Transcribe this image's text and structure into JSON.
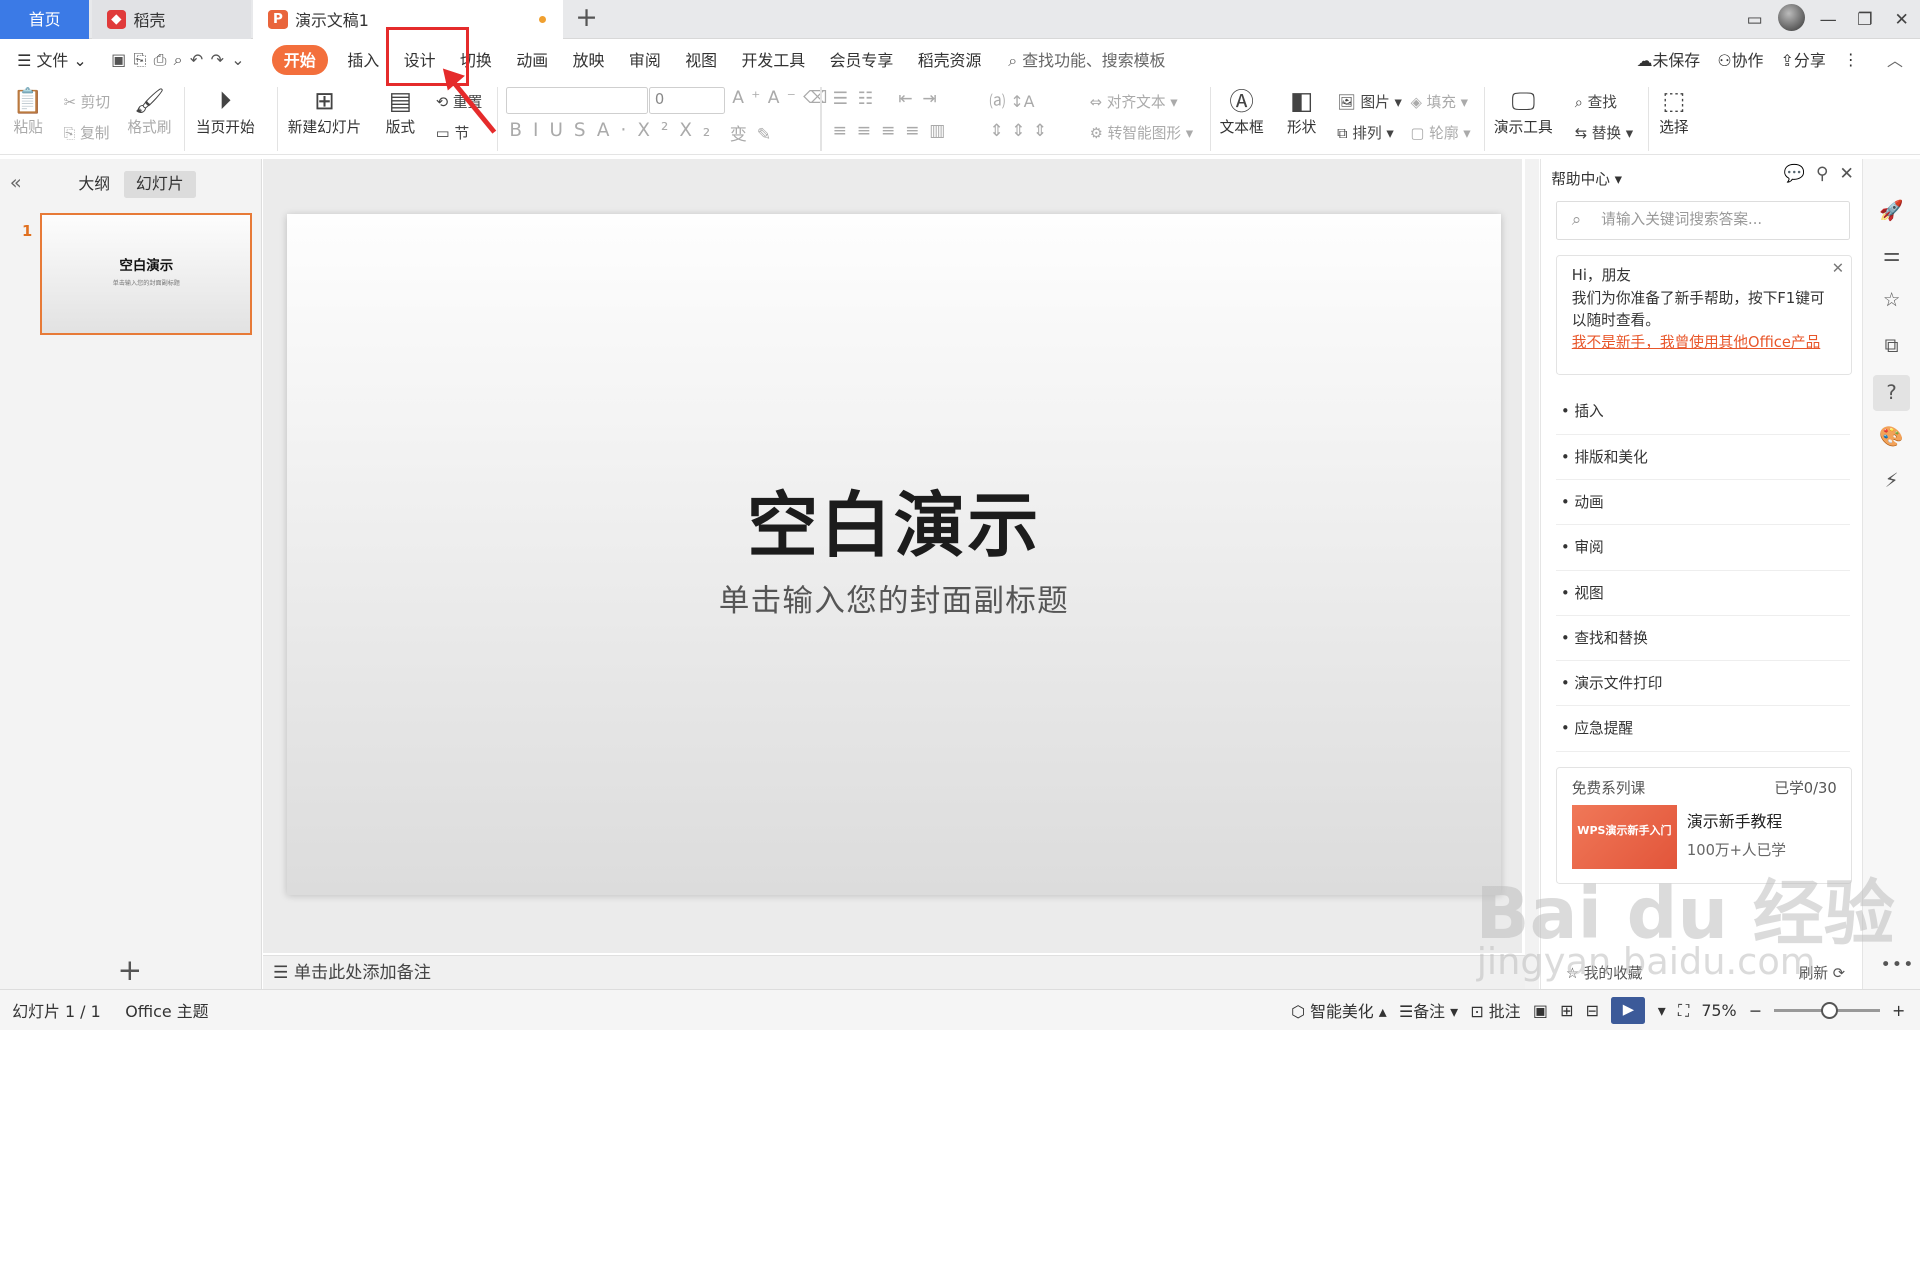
{
  "tabs": {
    "home": "首页",
    "daoke": "稻壳",
    "doc": "演示文稿1",
    "add": "+"
  },
  "menu": {
    "file": "文件",
    "items": [
      "开始",
      "插入",
      "设计",
      "切换",
      "动画",
      "放映",
      "审阅",
      "视图",
      "开发工具",
      "会员专享",
      "稻壳资源"
    ],
    "active_index": 0,
    "search": "查找功能、搜索模板",
    "unsaved": "未保存",
    "collab": "协作",
    "share": "分享"
  },
  "ribbon": {
    "paste": "粘贴",
    "cut": "剪切",
    "copy": "复制",
    "format_painter": "格式刷",
    "play_current": "当页开始",
    "new_slide": "新建幻灯片",
    "layout": "版式",
    "reset": "重置",
    "section": "节",
    "font_size": "0",
    "align_text": "对齐文本",
    "smart_art": "转智能图形",
    "textbox": "文本框",
    "shapes": "形状",
    "picture": "图片",
    "arrange": "排列",
    "fill": "填充",
    "outline": "轮廓",
    "present_tools": "演示工具",
    "find": "查找",
    "replace": "替换",
    "select": "选择"
  },
  "left_panel": {
    "outline_tab": "大纲",
    "slides_tab": "幻灯片",
    "slide_number": "1",
    "thumb_title": "空白演示",
    "thumb_sub": "单击输入您的封面副标题"
  },
  "slide": {
    "title": "空白演示",
    "subtitle": "单击输入您的封面副标题"
  },
  "notes": {
    "placeholder": "单击此处添加备注"
  },
  "help": {
    "title": "帮助中心",
    "search_placeholder": "请输入关键词搜索答案...",
    "greet_line1": "Hi，朋友",
    "greet_line2": "我们为你准备了新手帮助，按下F1键可以随时查看。",
    "greet_link": "我不是新手，我曾使用其他Office产品",
    "topics": [
      "插入",
      "排版和美化",
      "动画",
      "审阅",
      "视图",
      "查找和替换",
      "演示文件打印",
      "应急提醒"
    ],
    "course_label": "免费系列课",
    "course_progress": "已学0/30",
    "course_img_text": "WPS演示新手入门",
    "course_title": "演示新手教程",
    "course_learners": "100万+人已学",
    "foot_left": "我的收藏",
    "foot_right": "刷新"
  },
  "status": {
    "slide_count": "幻灯片 1 / 1",
    "theme": "Office 主题",
    "beautify": "智能美化",
    "notes": "备注",
    "comments": "批注",
    "zoom": "75%"
  },
  "watermark": {
    "line1": "Bai du 经验",
    "line2": "jingyan.baidu.com"
  },
  "colors": {
    "accent": "#f36f3c",
    "tab_home": "#3b7ae6",
    "annotation": "#e52b2b",
    "selected_border": "#e77a37"
  }
}
